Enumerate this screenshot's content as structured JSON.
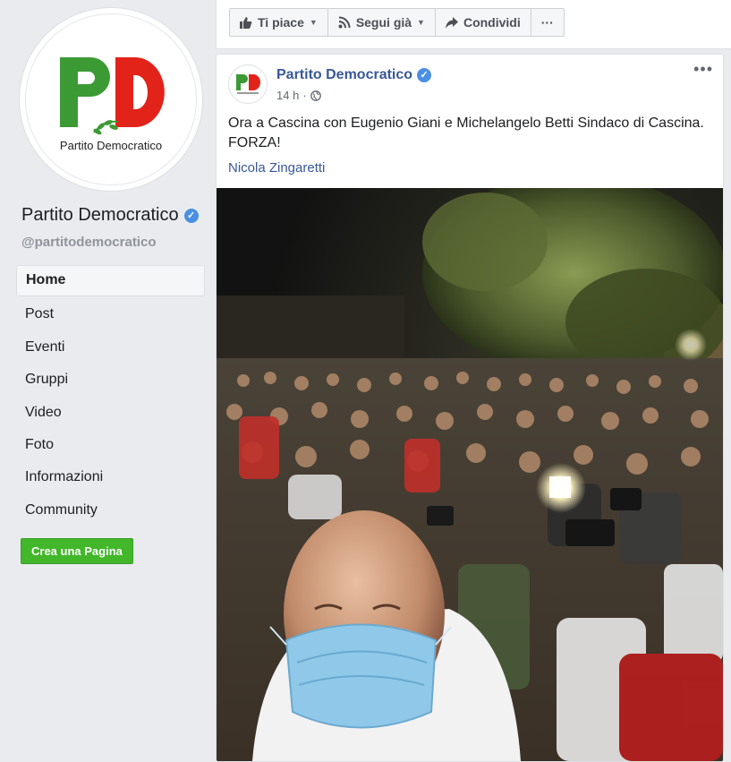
{
  "sidebar": {
    "logo": {
      "letters": "PD",
      "caption": "Partito Democratico"
    },
    "page_name": "Partito Democratico",
    "handle": "@partitodemocratico",
    "nav": [
      {
        "label": "Home",
        "active": true
      },
      {
        "label": "Post"
      },
      {
        "label": "Eventi"
      },
      {
        "label": "Gruppi"
      },
      {
        "label": "Video"
      },
      {
        "label": "Foto"
      },
      {
        "label": "Informazioni"
      },
      {
        "label": "Community"
      }
    ],
    "create_page_label": "Crea una Pagina"
  },
  "actionbar": {
    "like_label": "Ti piace",
    "follow_label": "Segui già",
    "share_label": "Condividi",
    "more_label": "···"
  },
  "post": {
    "author": "Partito Democratico",
    "time": "14 h",
    "text": "Ora a Cascina con Eugenio Giani e Michelangelo Betti Sindaco di Cascina. FORZA!",
    "tagged": "Nicola Zingaretti",
    "more_label": "•••"
  },
  "colors": {
    "brand_green": "#3c9a35",
    "brand_red": "#e2231a",
    "link_blue": "#385898",
    "button_green": "#42b72a",
    "verified_blue": "#4a90e2"
  }
}
